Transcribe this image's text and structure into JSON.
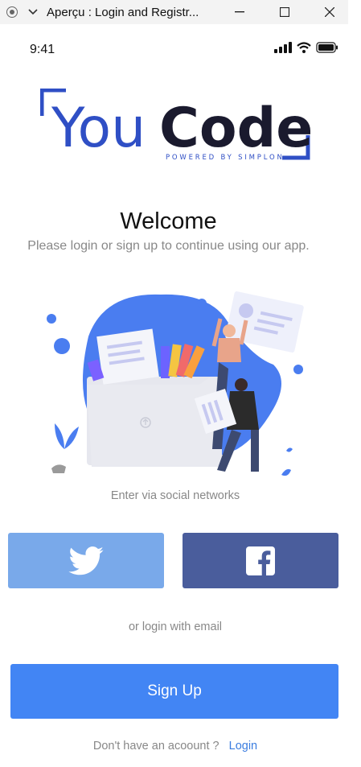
{
  "window": {
    "title": "Aperçu : Login and Registr...",
    "icons": [
      "record-icon",
      "chevron-down-icon",
      "minimize-icon",
      "maximize-icon",
      "close-icon"
    ]
  },
  "status_bar": {
    "time": "9:41",
    "icons": [
      "signal-icon",
      "wifi-icon",
      "battery-icon"
    ]
  },
  "logo": {
    "word_you": "You",
    "word_code": "Code",
    "tagline": "POWERED BY SIMPLON",
    "colors": {
      "you": "#2f4fc5",
      "code": "#1a1a2e",
      "bracket": "#2f4fc5"
    }
  },
  "header": {
    "title": "Welcome",
    "subtitle": "Please login or sign up to continue using our app."
  },
  "social": {
    "label": "Enter via social networks",
    "buttons": [
      {
        "name": "twitter",
        "icon": "twitter-bird-icon",
        "color": "#79a9ea"
      },
      {
        "name": "facebook",
        "icon": "facebook-f-icon",
        "color": "#4a5d9c"
      }
    ]
  },
  "email_label": "or login with email",
  "signup": {
    "label": "Sign Up",
    "color": "#4285f4"
  },
  "footer": {
    "question": "Don't have an acoount ?",
    "login_link": "Login"
  }
}
